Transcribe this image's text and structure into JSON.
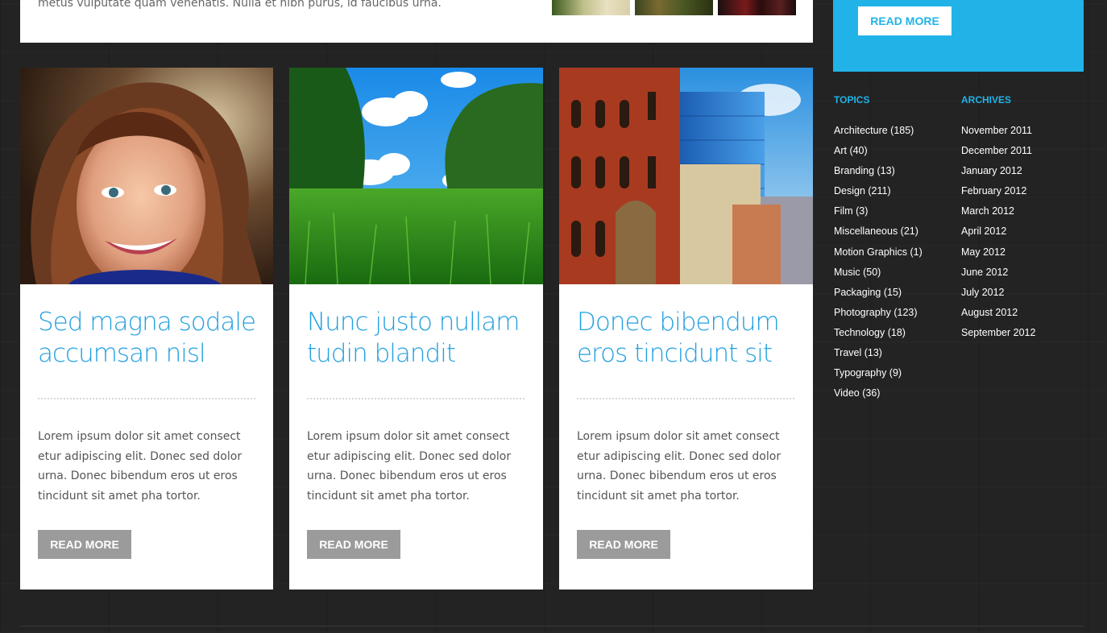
{
  "top_post": {
    "excerpt": "metus vulputate quam venenatis. Nulla et nibh purus, id faucibus urna."
  },
  "promo": {
    "button_label": "READ MORE",
    "accent_color": "#21b3e8"
  },
  "cards": [
    {
      "title": "Sed magna sodale accumsan nisl",
      "body": "Lorem ipsum dolor sit amet consect etur adipiscing elit. Donec sed dolor urna. Donec bibendum eros ut eros tincidunt sit amet pha tortor.",
      "button_label": "READ MORE",
      "image": "portrait-photo"
    },
    {
      "title": "Nunc justo nullam tudin blandit",
      "body": "Lorem ipsum dolor sit amet consect etur adipiscing elit. Donec sed dolor urna. Donec bibendum eros ut eros tincidunt sit amet pha tortor.",
      "button_label": "READ MORE",
      "image": "grass-sky-photo"
    },
    {
      "title": "Donec bibendum eros tincidunt sit",
      "body": "Lorem ipsum dolor sit amet consect etur adipiscing elit. Donec sed dolor urna. Donec bibendum eros ut eros tincidunt sit amet pha tortor.",
      "button_label": "READ MORE",
      "image": "city-buildings-photo"
    }
  ],
  "sidebar": {
    "topics": {
      "title": "TOPICS",
      "items": [
        "Architecture (185)",
        "Art (40)",
        "Branding (13)",
        "Design (211)",
        "Film (3)",
        "Miscellaneous (21)",
        "Motion Graphics (1)",
        "Music (50)",
        "Packaging (15)",
        "Photography (123)",
        "Technology (18)",
        "Travel (13)",
        "Typography (9)",
        "Video (36)"
      ]
    },
    "archives": {
      "title": "ARCHIVES",
      "items": [
        "November 2011",
        "December 2011",
        "January 2012",
        "February 2012",
        "March 2012",
        "April 2012",
        "May 2012",
        "June 2012",
        "July 2012",
        "August 2012",
        "September 2012"
      ]
    }
  }
}
